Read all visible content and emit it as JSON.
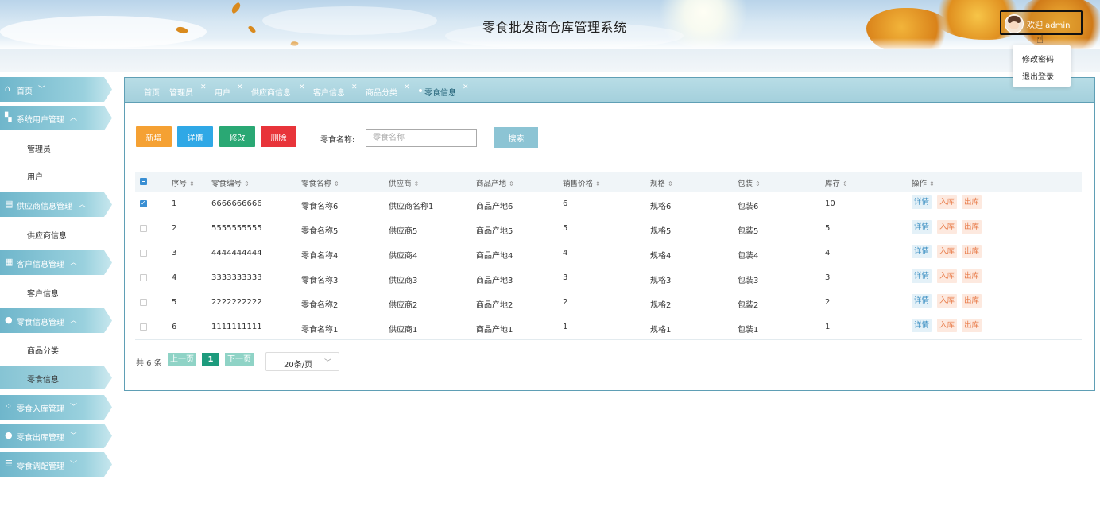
{
  "header": {
    "title": "零食批发商仓库管理系统",
    "welcome": "欢迎 admin",
    "menu": [
      "修改密码",
      "退出登录"
    ]
  },
  "sidebar": {
    "items": [
      {
        "label": "首页",
        "icon": "home-icon",
        "expanded": false,
        "children": []
      },
      {
        "label": "系统用户管理",
        "icon": "users-icon",
        "expanded": true,
        "children": [
          "管理员",
          "用户"
        ]
      },
      {
        "label": "供应商信息管理",
        "icon": "supplier-icon",
        "expanded": true,
        "children": [
          "供应商信息"
        ]
      },
      {
        "label": "客户信息管理",
        "icon": "customer-icon",
        "expanded": true,
        "children": [
          "客户信息"
        ]
      },
      {
        "label": "零食信息管理",
        "icon": "snack-icon",
        "expanded": true,
        "children": [
          "商品分类",
          "零食信息"
        ]
      },
      {
        "label": "零食入库管理",
        "icon": "stock-in-icon",
        "expanded": false,
        "children": []
      },
      {
        "label": "零食出库管理",
        "icon": "stock-out-icon",
        "expanded": false,
        "children": []
      },
      {
        "label": "零食调配管理",
        "icon": "allocation-icon",
        "expanded": false,
        "children": []
      }
    ],
    "active": "零食信息"
  },
  "tabs": [
    "首页",
    "管理员",
    "用户",
    "供应商信息",
    "客户信息",
    "商品分类",
    "零食信息"
  ],
  "active_tab": "零食信息",
  "toolbar": {
    "add": "新增",
    "detail": "详情",
    "edit": "修改",
    "delete": "删除",
    "search_label": "零食名称:",
    "search_placeholder": "零食名称",
    "search_button": "搜索"
  },
  "table": {
    "columns": [
      "序号",
      "零食编号",
      "零食名称",
      "供应商",
      "商品产地",
      "销售价格",
      "规格",
      "包装",
      "库存",
      "操作"
    ],
    "rows": [
      {
        "no": "1",
        "code": "6666666666",
        "name": "零食名称6",
        "supplier": "供应商名称1",
        "origin": "商品产地6",
        "price": "6",
        "spec": "规格6",
        "pack": "包装6",
        "stock": "10",
        "checked": true
      },
      {
        "no": "2",
        "code": "5555555555",
        "name": "零食名称5",
        "supplier": "供应商5",
        "origin": "商品产地5",
        "price": "5",
        "spec": "规格5",
        "pack": "包装5",
        "stock": "5",
        "checked": false
      },
      {
        "no": "3",
        "code": "4444444444",
        "name": "零食名称4",
        "supplier": "供应商4",
        "origin": "商品产地4",
        "price": "4",
        "spec": "规格4",
        "pack": "包装4",
        "stock": "4",
        "checked": false
      },
      {
        "no": "4",
        "code": "3333333333",
        "name": "零食名称3",
        "supplier": "供应商3",
        "origin": "商品产地3",
        "price": "3",
        "spec": "规格3",
        "pack": "包装3",
        "stock": "3",
        "checked": false
      },
      {
        "no": "5",
        "code": "2222222222",
        "name": "零食名称2",
        "supplier": "供应商2",
        "origin": "商品产地2",
        "price": "2",
        "spec": "规格2",
        "pack": "包装2",
        "stock": "2",
        "checked": false
      },
      {
        "no": "6",
        "code": "1111111111",
        "name": "零食名称1",
        "supplier": "供应商1",
        "origin": "商品产地1",
        "price": "1",
        "spec": "规格1",
        "pack": "包装1",
        "stock": "1",
        "checked": false
      }
    ],
    "actions": [
      "详情",
      "入库",
      "出库"
    ]
  },
  "pagination": {
    "total": "共 6 条",
    "prev": "上一页",
    "current": "1",
    "next": "下一页",
    "page_size": "20条/页"
  },
  "colors": {
    "accent": "#6fb6cb",
    "add": "#f5a133",
    "detail": "#2fa8e6",
    "edit": "#2aa874",
    "delete": "#e8343a",
    "search": "#8cc4d4",
    "page_current": "#1d9b7d"
  }
}
